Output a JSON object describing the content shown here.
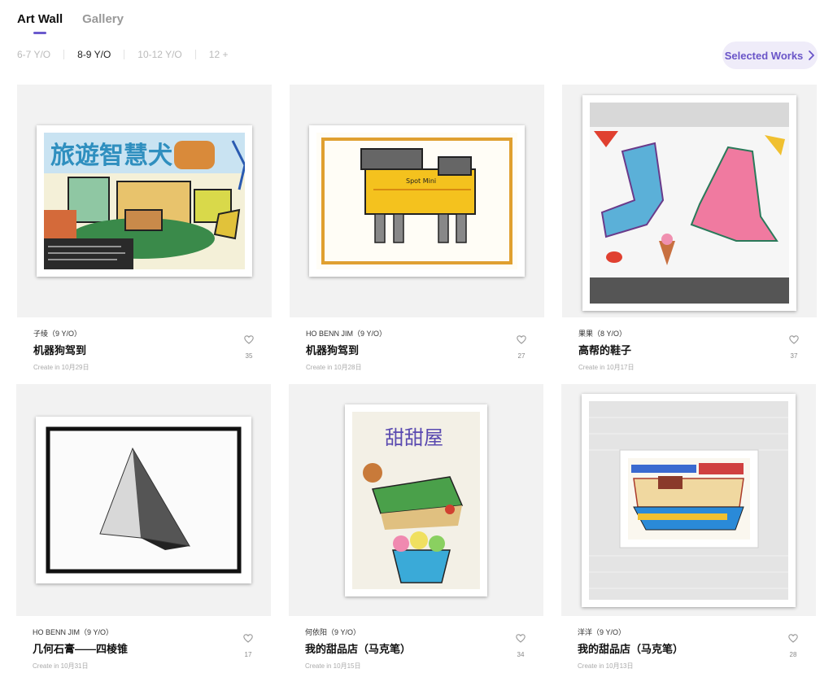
{
  "tabs": [
    {
      "label": "Art Wall",
      "active": true
    },
    {
      "label": "Gallery",
      "active": false
    }
  ],
  "age_filters": [
    {
      "label": "6-7 Y/O",
      "active": false
    },
    {
      "label": "8-9 Y/O",
      "active": true
    },
    {
      "label": "10-12 Y/O",
      "active": false
    },
    {
      "label": "12 +",
      "active": false
    }
  ],
  "selected_works": {
    "label": "Selected Works",
    "icon": "chevron-right-icon"
  },
  "accent_color": "#6a55c8",
  "artworks": [
    {
      "author": "子绫（9 Y/O）",
      "title": "机器狗驾到",
      "date": "Create in 10月29日",
      "likes": "35",
      "like_icon": "heart-outline-icon"
    },
    {
      "author": "HO BENN JIM（9 Y/O）",
      "title": "机器狗驾到",
      "date": "Create in 10月28日",
      "likes": "27",
      "like_icon": "heart-outline-icon"
    },
    {
      "author": "果果（8 Y/O）",
      "title": "高帮的鞋子",
      "date": "Create in 10月17日",
      "likes": "37",
      "like_icon": "heart-outline-icon"
    },
    {
      "author": "HO BENN JIM（9 Y/O）",
      "title": "几何石膏——四棱锥",
      "date": "Create in 10月31日",
      "likes": "17",
      "like_icon": "heart-outline-icon"
    },
    {
      "author": "何依阳（9 Y/O）",
      "title": "我的甜品店（马克笔）",
      "date": "Create in 10月15日",
      "likes": "34",
      "like_icon": "heart-outline-icon"
    },
    {
      "author": "洋洋（9 Y/O）",
      "title": "我的甜品店（马克笔）",
      "date": "Create in 10月13日",
      "likes": "28",
      "like_icon": "heart-outline-icon"
    }
  ],
  "artwork_inscriptions": {
    "art1_heading": "旅遊智慧犬",
    "art2_label": "Spot Mini",
    "art5_heading": "甜甜屋"
  }
}
